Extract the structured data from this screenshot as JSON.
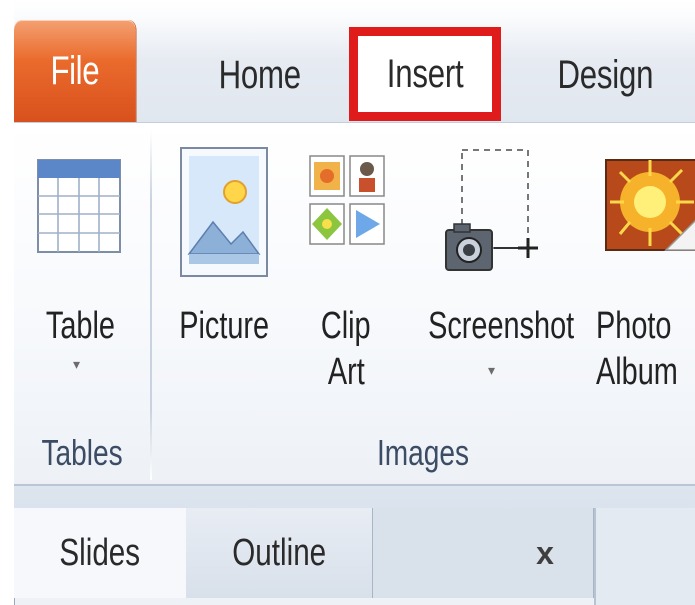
{
  "tabs": {
    "file": "File",
    "home": "Home",
    "insert": "Insert",
    "design": "Design"
  },
  "ribbon": {
    "groups": [
      {
        "name": "Tables",
        "buttons": [
          {
            "label": "Table",
            "dropdown": "▾"
          }
        ]
      },
      {
        "name": "Images",
        "buttons": [
          {
            "label": "Picture"
          },
          {
            "label_line1": "Clip",
            "label_line2": "Art"
          },
          {
            "label": "Screenshot",
            "dropdown": "▾"
          },
          {
            "label_line1": "Photo",
            "label_line2": "Album"
          }
        ]
      }
    ]
  },
  "pane": {
    "tabs": [
      "Slides",
      "Outline"
    ],
    "close": "x"
  },
  "colors": {
    "file_tab": "#e6642a",
    "highlight_box": "#e01b1b",
    "group_label": "#3c4c64"
  }
}
